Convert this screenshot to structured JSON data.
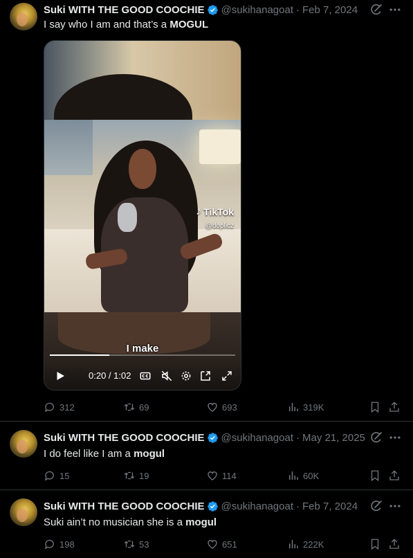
{
  "tweets": [
    {
      "name": "Suki WITH THE GOOD COOCHIE",
      "handle": "@sukihanagoat",
      "date": "Feb 7, 2024",
      "text_before": "I say who I am and that’s a ",
      "text_bold": "MOGUL",
      "video": {
        "caption": "I make",
        "time": "0:20 / 1:02",
        "progress": 0.32,
        "watermark": "TikTok",
        "watermark_handle": "@doplicz"
      },
      "replies": "312",
      "reposts": "69",
      "likes": "693",
      "views": "319K"
    },
    {
      "name": "Suki WITH THE GOOD COOCHIE",
      "handle": "@sukihanagoat",
      "date": "May 21, 2025",
      "text_before": "I do feel like I am a ",
      "text_bold": "mogul",
      "replies": "15",
      "reposts": "19",
      "likes": "114",
      "views": "60K"
    },
    {
      "name": "Suki WITH THE GOOD COOCHIE",
      "handle": "@sukihanagoat",
      "date": "Feb 7, 2024",
      "text_before": "Suki ain’t no musician she is a ",
      "text_bold": "mogul",
      "replies": "198",
      "reposts": "53",
      "likes": "651",
      "views": "222K"
    }
  ],
  "icons": {
    "verified": "verified-badge-icon",
    "grok": "grok-icon",
    "more": "more-icon",
    "reply": "reply-icon",
    "repost": "repost-icon",
    "like": "like-icon",
    "views": "views-icon",
    "bookmark": "bookmark-icon",
    "share": "share-icon"
  },
  "colors": {
    "background": "#000000",
    "text": "#e7e9ea",
    "muted": "#71767b",
    "verified": "#1d9bf0",
    "divider": "#2f3336"
  }
}
